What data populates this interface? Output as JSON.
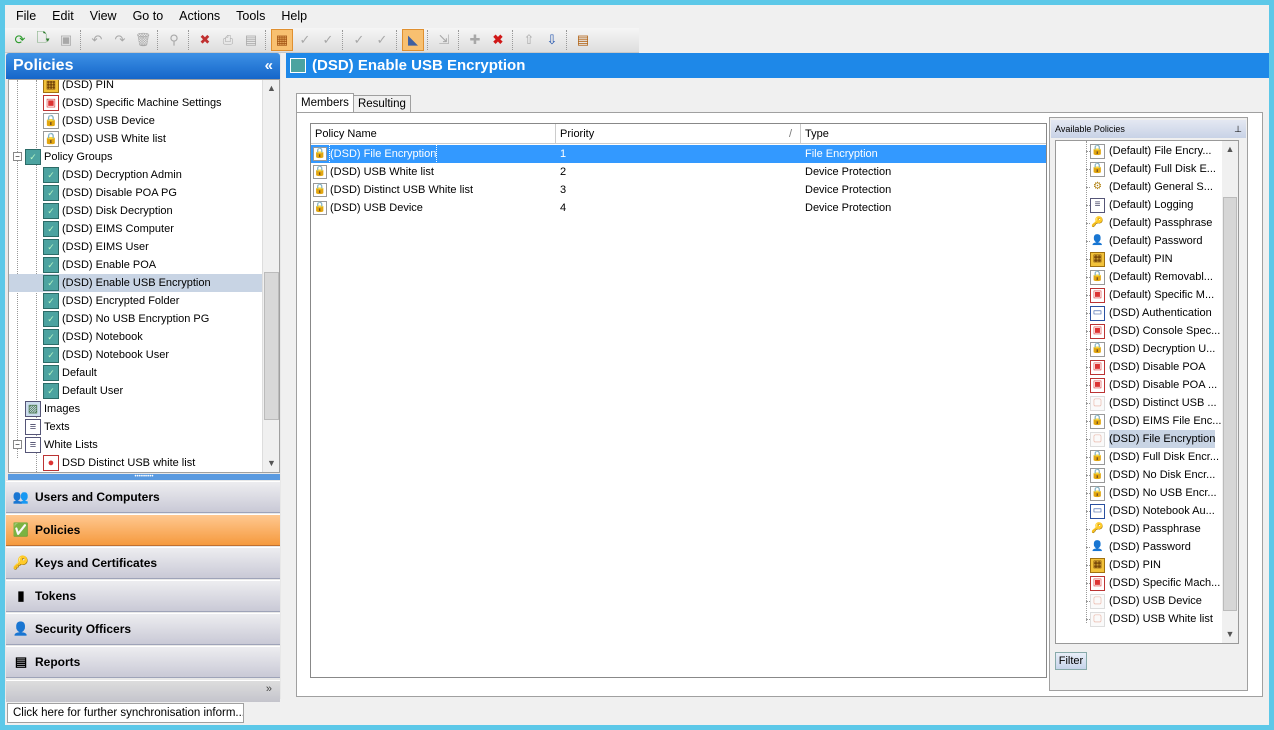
{
  "menu": [
    "File",
    "Edit",
    "View",
    "Go to",
    "Actions",
    "Tools",
    "Help"
  ],
  "left_panel": {
    "title": "Policies",
    "collapse_glyph": "«",
    "tree": [
      {
        "label": "(DSD) PIN",
        "icon": "pin-icon",
        "indent": 2
      },
      {
        "label": "(DSD) Specific Machine Settings",
        "icon": "machine-settings-icon",
        "indent": 2
      },
      {
        "label": "(DSD) USB Device",
        "icon": "usb-device-icon",
        "indent": 2
      },
      {
        "label": "(DSD) USB White list",
        "icon": "usb-whitelist-icon",
        "indent": 2
      },
      {
        "label": "Policy Groups",
        "icon": "policy-group-icon",
        "indent": 1,
        "expander": "−"
      },
      {
        "label": "(DSD) Decryption Admin",
        "icon": "policy-group-icon",
        "indent": 2
      },
      {
        "label": "(DSD) Disable POA PG",
        "icon": "policy-group-icon",
        "indent": 2
      },
      {
        "label": "(DSD) Disk Decryption",
        "icon": "policy-group-icon",
        "indent": 2
      },
      {
        "label": "(DSD) EIMS Computer",
        "icon": "policy-group-icon",
        "indent": 2
      },
      {
        "label": "(DSD) EIMS User",
        "icon": "policy-group-icon",
        "indent": 2
      },
      {
        "label": "(DSD) Enable POA",
        "icon": "policy-group-icon",
        "indent": 2
      },
      {
        "label": "(DSD) Enable USB Encryption",
        "icon": "policy-group-icon",
        "indent": 2,
        "selected": true
      },
      {
        "label": "(DSD) Encrypted Folder",
        "icon": "policy-group-icon",
        "indent": 2
      },
      {
        "label": "(DSD) No USB Encryption PG",
        "icon": "policy-group-icon",
        "indent": 2
      },
      {
        "label": "(DSD) Notebook",
        "icon": "policy-group-icon",
        "indent": 2
      },
      {
        "label": "(DSD) Notebook User",
        "icon": "policy-group-icon",
        "indent": 2
      },
      {
        "label": "Default",
        "icon": "policy-group-icon",
        "indent": 2
      },
      {
        "label": "Default User",
        "icon": "policy-group-icon",
        "indent": 2
      },
      {
        "label": "Images",
        "icon": "image-icon",
        "indent": 1
      },
      {
        "label": "Texts",
        "icon": "text-icon",
        "indent": 1
      },
      {
        "label": "White Lists",
        "icon": "whitelist-icon",
        "indent": 1,
        "expander": "−"
      },
      {
        "label": "DSD Distinct USB white list",
        "icon": "usb-list-icon",
        "indent": 2
      }
    ]
  },
  "nav": [
    {
      "label": "Users and Computers",
      "icon": "users-icon",
      "glyph": "👥"
    },
    {
      "label": "Policies",
      "icon": "policies-icon",
      "glyph": "✅",
      "active": true
    },
    {
      "label": "Keys and Certificates",
      "icon": "keys-icon",
      "glyph": "🔑"
    },
    {
      "label": "Tokens",
      "icon": "tokens-icon",
      "glyph": "▮"
    },
    {
      "label": "Security Officers",
      "icon": "security-officer-icon",
      "glyph": "👤"
    },
    {
      "label": "Reports",
      "icon": "reports-icon",
      "glyph": "▤"
    }
  ],
  "status_text": "Click here for further synchronisation inform...",
  "right_panel": {
    "title": "(DSD) Enable USB Encryption",
    "tabs": [
      "Members",
      "Resulting"
    ],
    "columns": [
      "Policy Name",
      "Priority",
      "Type"
    ],
    "sort_glyph": "/",
    "rows": [
      {
        "name": "(DSD) File Encryption",
        "priority": "1",
        "type": "File Encryption",
        "selected": true
      },
      {
        "name": "(DSD) USB White list",
        "priority": "2",
        "type": "Device Protection"
      },
      {
        "name": "(DSD) Distinct USB White list",
        "priority": "3",
        "type": "Device Protection"
      },
      {
        "name": "(DSD) USB Device",
        "priority": "4",
        "type": "Device Protection"
      }
    ]
  },
  "available": {
    "title": "Available Policies",
    "pin_glyph": "⊥",
    "filter_label": "Filter",
    "items": [
      {
        "label": "(Default) File Encry...",
        "icon": "file-encryption-icon"
      },
      {
        "label": "(Default) Full Disk E...",
        "icon": "full-disk-icon"
      },
      {
        "label": "(Default) General S...",
        "icon": "general-settings-icon"
      },
      {
        "label": "(Default) Logging",
        "icon": "logging-icon"
      },
      {
        "label": "(Default) Passphrase",
        "icon": "passphrase-icon"
      },
      {
        "label": "(Default) Password",
        "icon": "password-icon"
      },
      {
        "label": "(Default) PIN",
        "icon": "pin-icon"
      },
      {
        "label": "(Default) Removabl...",
        "icon": "removable-icon"
      },
      {
        "label": "(Default) Specific M...",
        "icon": "machine-settings-icon"
      },
      {
        "label": "(DSD) Authentication",
        "icon": "authentication-icon"
      },
      {
        "label": "(DSD) Console Spec...",
        "icon": "console-icon"
      },
      {
        "label": "(DSD) Decryption U...",
        "icon": "decryption-icon"
      },
      {
        "label": "(DSD) Disable POA",
        "icon": "poa-icon"
      },
      {
        "label": "(DSD) Disable POA ...",
        "icon": "poa-icon"
      },
      {
        "label": "(DSD) Distinct USB ...",
        "icon": "usb-faint-icon"
      },
      {
        "label": "(DSD) EIMS File Enc...",
        "icon": "file-encryption-icon"
      },
      {
        "label": "(DSD) File Encryption",
        "icon": "file-encryption-faint-icon",
        "selected": true
      },
      {
        "label": "(DSD) Full Disk Encr...",
        "icon": "full-disk-icon"
      },
      {
        "label": "(DSD) No Disk Encr...",
        "icon": "full-disk-icon"
      },
      {
        "label": "(DSD) No USB Encr...",
        "icon": "usb-device-icon"
      },
      {
        "label": "(DSD) Notebook Au...",
        "icon": "authentication-icon"
      },
      {
        "label": "(DSD) Passphrase",
        "icon": "passphrase-icon"
      },
      {
        "label": "(DSD) Password",
        "icon": "password-icon"
      },
      {
        "label": "(DSD) PIN",
        "icon": "pin-icon"
      },
      {
        "label": "(DSD) Specific Mach...",
        "icon": "machine-settings-icon"
      },
      {
        "label": "(DSD) USB Device",
        "icon": "usb-faint-icon"
      },
      {
        "label": "(DSD) USB White list",
        "icon": "usb-faint-icon"
      }
    ]
  },
  "toolbar_icons": [
    "refresh-icon",
    "new-icon",
    "save-icon",
    "undo-icon",
    "redo-icon",
    "delete-icon",
    "find-icon",
    "remove-filter-icon",
    "print-icon",
    "print-preview-icon",
    "toggle-view-icon",
    "check-icon",
    "check-all-icon",
    "verify-icon",
    "verify-all-icon",
    "highlight-icon",
    "import-icon",
    "add-icon",
    "remove-icon",
    "move-up-icon",
    "move-down-icon",
    "properties-icon"
  ],
  "colors": {
    "header_blue": "#1e88e8",
    "selection_blue": "#3399ff",
    "active_nav_orange": "#f59a3e"
  }
}
